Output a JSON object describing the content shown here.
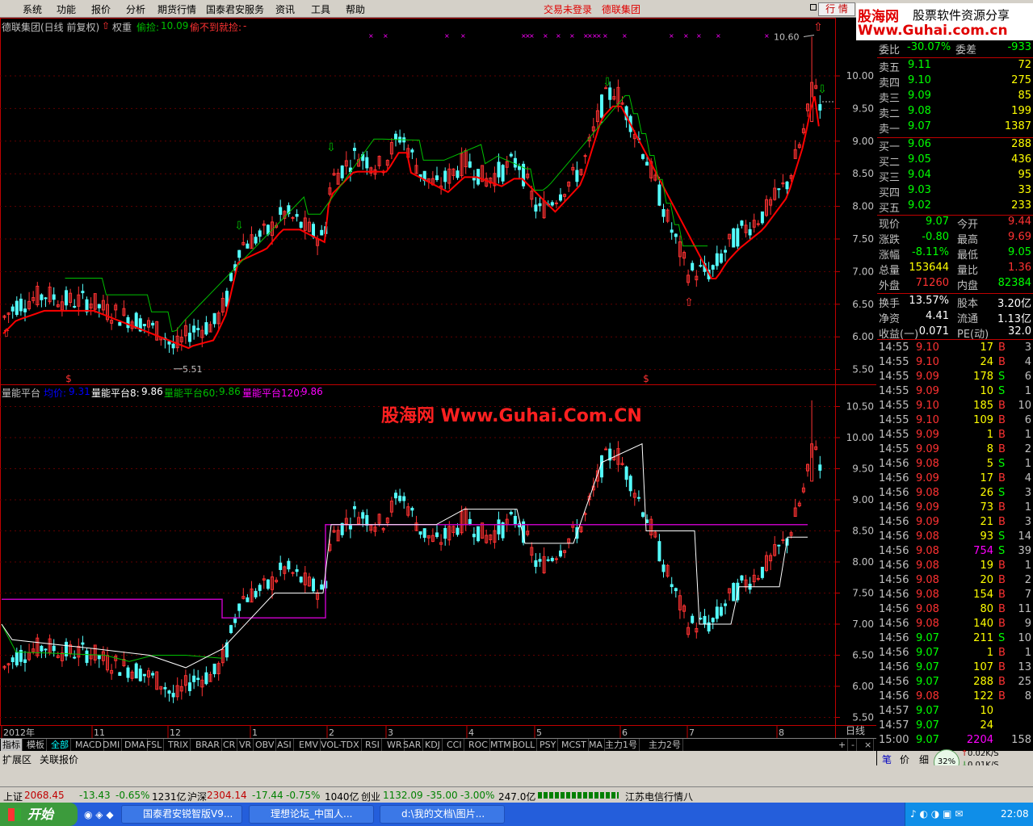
{
  "menu": {
    "items": [
      "系统",
      "功能",
      "报价",
      "分析",
      "期货行情",
      "国泰君安服务",
      "资讯",
      "工具",
      "帮助"
    ],
    "login_status": "交易未登录",
    "stock_link": "德联集团",
    "hq_button": "行 情"
  },
  "logo": {
    "brand": "股海网",
    "slogan": "股票软件资源分享",
    "url": "Www.Guhai.com.cn"
  },
  "main_panel": {
    "title": "德联集团(日线 前复权)",
    "weight_label": "权重",
    "pick_label": "偷捡:",
    "pick_value": "10.09",
    "fail_label": "偷不到就捡:",
    "fail_value": "-"
  },
  "indicator_panel": {
    "name": "量能平台",
    "avg_label": "均价:",
    "avg_value": "9.31",
    "lines": [
      {
        "label": "量能平台8:",
        "value": "9.86"
      },
      {
        "label": "量能平台60:",
        "value": "9.86"
      },
      {
        "label": "量能平台120:",
        "value": "9.86"
      }
    ]
  },
  "watermark": "股海网 Www.Guhai.Com.CN",
  "chart_data": {
    "type": "candlestick",
    "price_axis": [
      "10.00",
      "9.50",
      "9.00",
      "8.50",
      "8.00",
      "7.50",
      "7.00",
      "6.50",
      "6.00",
      "5.50"
    ],
    "indicator_axis": [
      "10.50",
      "10.00",
      "9.50",
      "9.00",
      "8.50",
      "8.00",
      "7.50",
      "7.00",
      "6.50",
      "6.00",
      "5.50"
    ],
    "annotations": {
      "high": "10.60",
      "low": "5.51"
    },
    "x_labels": [
      "2012年",
      "11",
      "12",
      "1",
      "2",
      "3",
      "4",
      "5",
      "6",
      "7",
      "8"
    ],
    "period": "日线"
  },
  "quote": {
    "wb_label": "委比",
    "wb_value": "-30.07%",
    "wc_label": "委差",
    "wc_value": "-933",
    "asks": [
      {
        "label": "卖五",
        "price": "9.11",
        "vol": "72"
      },
      {
        "label": "卖四",
        "price": "9.10",
        "vol": "275"
      },
      {
        "label": "卖三",
        "price": "9.09",
        "vol": "85"
      },
      {
        "label": "卖二",
        "price": "9.08",
        "vol": "199"
      },
      {
        "label": "卖一",
        "price": "9.07",
        "vol": "1387"
      }
    ],
    "bids": [
      {
        "label": "买一",
        "price": "9.06",
        "vol": "288"
      },
      {
        "label": "买二",
        "price": "9.05",
        "vol": "436"
      },
      {
        "label": "买三",
        "price": "9.04",
        "vol": "95"
      },
      {
        "label": "买四",
        "price": "9.03",
        "vol": "33"
      },
      {
        "label": "买五",
        "price": "9.02",
        "vol": "233"
      }
    ],
    "stats": [
      [
        "现价",
        "9.07",
        "今开",
        "9.44"
      ],
      [
        "涨跌",
        "-0.80",
        "最高",
        "9.69"
      ],
      [
        "涨幅",
        "-8.11%",
        "最低",
        "9.05"
      ],
      [
        "总量",
        "153644",
        "量比",
        "1.36"
      ],
      [
        "外盘",
        "71260",
        "内盘",
        "82384"
      ],
      [
        "换手",
        "13.57%",
        "股本",
        "3.20亿"
      ],
      [
        "净资",
        "4.41",
        "流通",
        "1.13亿"
      ],
      [
        "收益(一)",
        "0.071",
        "PE(动)",
        "32.0"
      ]
    ],
    "ticks": [
      [
        "14:55",
        "9.10",
        "17",
        "B",
        "3"
      ],
      [
        "14:55",
        "9.10",
        "24",
        "B",
        "4"
      ],
      [
        "14:55",
        "9.09",
        "178",
        "S",
        "6"
      ],
      [
        "14:55",
        "9.09",
        "10",
        "S",
        "1"
      ],
      [
        "14:55",
        "9.10",
        "185",
        "B",
        "10"
      ],
      [
        "14:55",
        "9.10",
        "109",
        "B",
        "6"
      ],
      [
        "14:55",
        "9.09",
        "1",
        "B",
        "1"
      ],
      [
        "14:55",
        "9.09",
        "8",
        "B",
        "2"
      ],
      [
        "14:56",
        "9.08",
        "5",
        "S",
        "1"
      ],
      [
        "14:56",
        "9.09",
        "17",
        "B",
        "4"
      ],
      [
        "14:56",
        "9.08",
        "26",
        "S",
        "3"
      ],
      [
        "14:56",
        "9.09",
        "73",
        "B",
        "1"
      ],
      [
        "14:56",
        "9.09",
        "21",
        "B",
        "3"
      ],
      [
        "14:56",
        "9.08",
        "93",
        "S",
        "14"
      ],
      [
        "14:56",
        "9.08",
        "754",
        "S",
        "39"
      ],
      [
        "14:56",
        "9.08",
        "19",
        "B",
        "1"
      ],
      [
        "14:56",
        "9.08",
        "20",
        "B",
        "2"
      ],
      [
        "14:56",
        "9.08",
        "154",
        "B",
        "7"
      ],
      [
        "14:56",
        "9.08",
        "80",
        "B",
        "11"
      ],
      [
        "14:56",
        "9.08",
        "140",
        "B",
        "9"
      ],
      [
        "14:56",
        "9.07",
        "211",
        "S",
        "10"
      ],
      [
        "14:56",
        "9.07",
        "1",
        "B",
        "1"
      ],
      [
        "14:56",
        "9.07",
        "107",
        "B",
        "13"
      ],
      [
        "14:56",
        "9.07",
        "288",
        "B",
        "25"
      ],
      [
        "14:56",
        "9.08",
        "122",
        "B",
        "8"
      ],
      [
        "14:57",
        "9.07",
        "10",
        "",
        ""
      ],
      [
        "14:57",
        "9.07",
        "24",
        "",
        ""
      ],
      [
        "15:00",
        "9.07",
        "2204",
        "",
        "158"
      ]
    ]
  },
  "tabs": [
    "指标",
    "模板",
    "全部",
    "MACD",
    "DMI",
    "DMA",
    "FSL",
    "TRIX",
    "BRAR",
    "CR",
    "VR",
    "OBV",
    "ASI",
    "EMV",
    "VOL-TDX",
    "RSI",
    "WR",
    "SAR",
    "KDJ",
    "CCI",
    "ROC",
    "MTM",
    "BOLL",
    "PSY",
    "MCST",
    "MA",
    "主力1号",
    "主力2号"
  ],
  "ext": {
    "ext_label": "扩展区",
    "linked_label": "关联报价"
  },
  "sidetabs": [
    "笔",
    "价",
    "细"
  ],
  "speed": {
    "pct": "32%",
    "up": "0.02K/S",
    "down": "0.01K/S"
  },
  "status": {
    "sh_label": "上证",
    "sh_val": "2068.45",
    "sh_chg": "-13.43",
    "sh_pct": "-0.65%",
    "sh_amt": "1231亿",
    "hs_label": "沪深",
    "hs_val": "2304.14",
    "hs_chg": "-17.44",
    "hs_pct": "-0.75%",
    "hs_amt": "1040亿",
    "cy_label": "创业",
    "cy_val": "1132.09",
    "cy_chg": "-35.00",
    "cy_pct": "-3.00%",
    "cy_amt": "247.0亿",
    "server": "江苏电信行情八"
  },
  "taskbar": {
    "start": "开始",
    "tasks": [
      "国泰君安锐智版V9...",
      "理想论坛_中国人...",
      "d:\\我的文档\\图片..."
    ],
    "clock": "22:08"
  },
  "colors": {
    "up": "#ff3232",
    "down": "#54ffff",
    "green": "#00c000",
    "magenta": "#ff00ff",
    "yellow": "#ffff00"
  }
}
